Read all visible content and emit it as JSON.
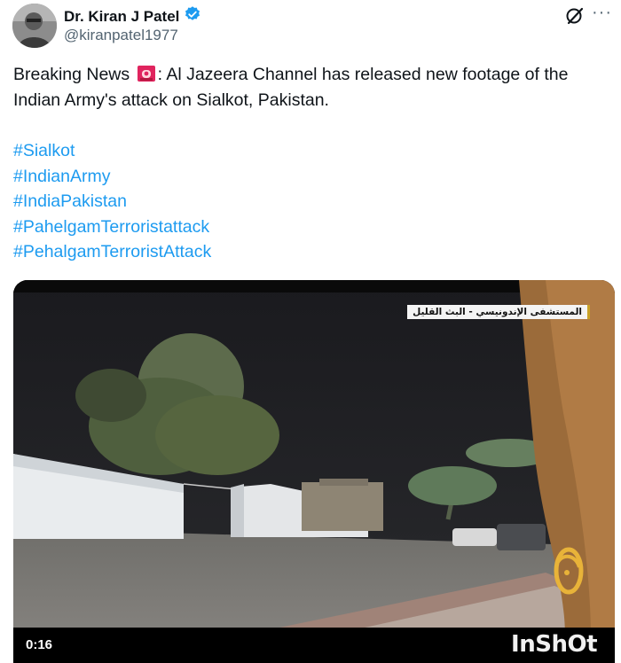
{
  "author": {
    "display_name": "Dr. Kiran J Patel",
    "handle": "@kiranpatel1977",
    "verified": true,
    "verified_color": "#1d9bf0"
  },
  "actions": {
    "grok_icon": "grok-icon",
    "more_label": "···"
  },
  "tweet": {
    "text_before": "Breaking News",
    "emoji": "police-car-light-icon",
    "text_after": ": Al Jazeera Channel has released new footage of the Indian Army's attack on Sialkot, Pakistan.",
    "hashtags": [
      "#Sialkot",
      "#IndianArmy",
      "#IndiaPakistan",
      "#PahelgamTerroristattack",
      "#PehalgamTerroristAttack"
    ],
    "hashtag_color": "#1d9bf0"
  },
  "media": {
    "channel_caption": "المستشفى الإندونيسي - البث القليل",
    "duration": "0:16",
    "watermark": "InShOt"
  }
}
